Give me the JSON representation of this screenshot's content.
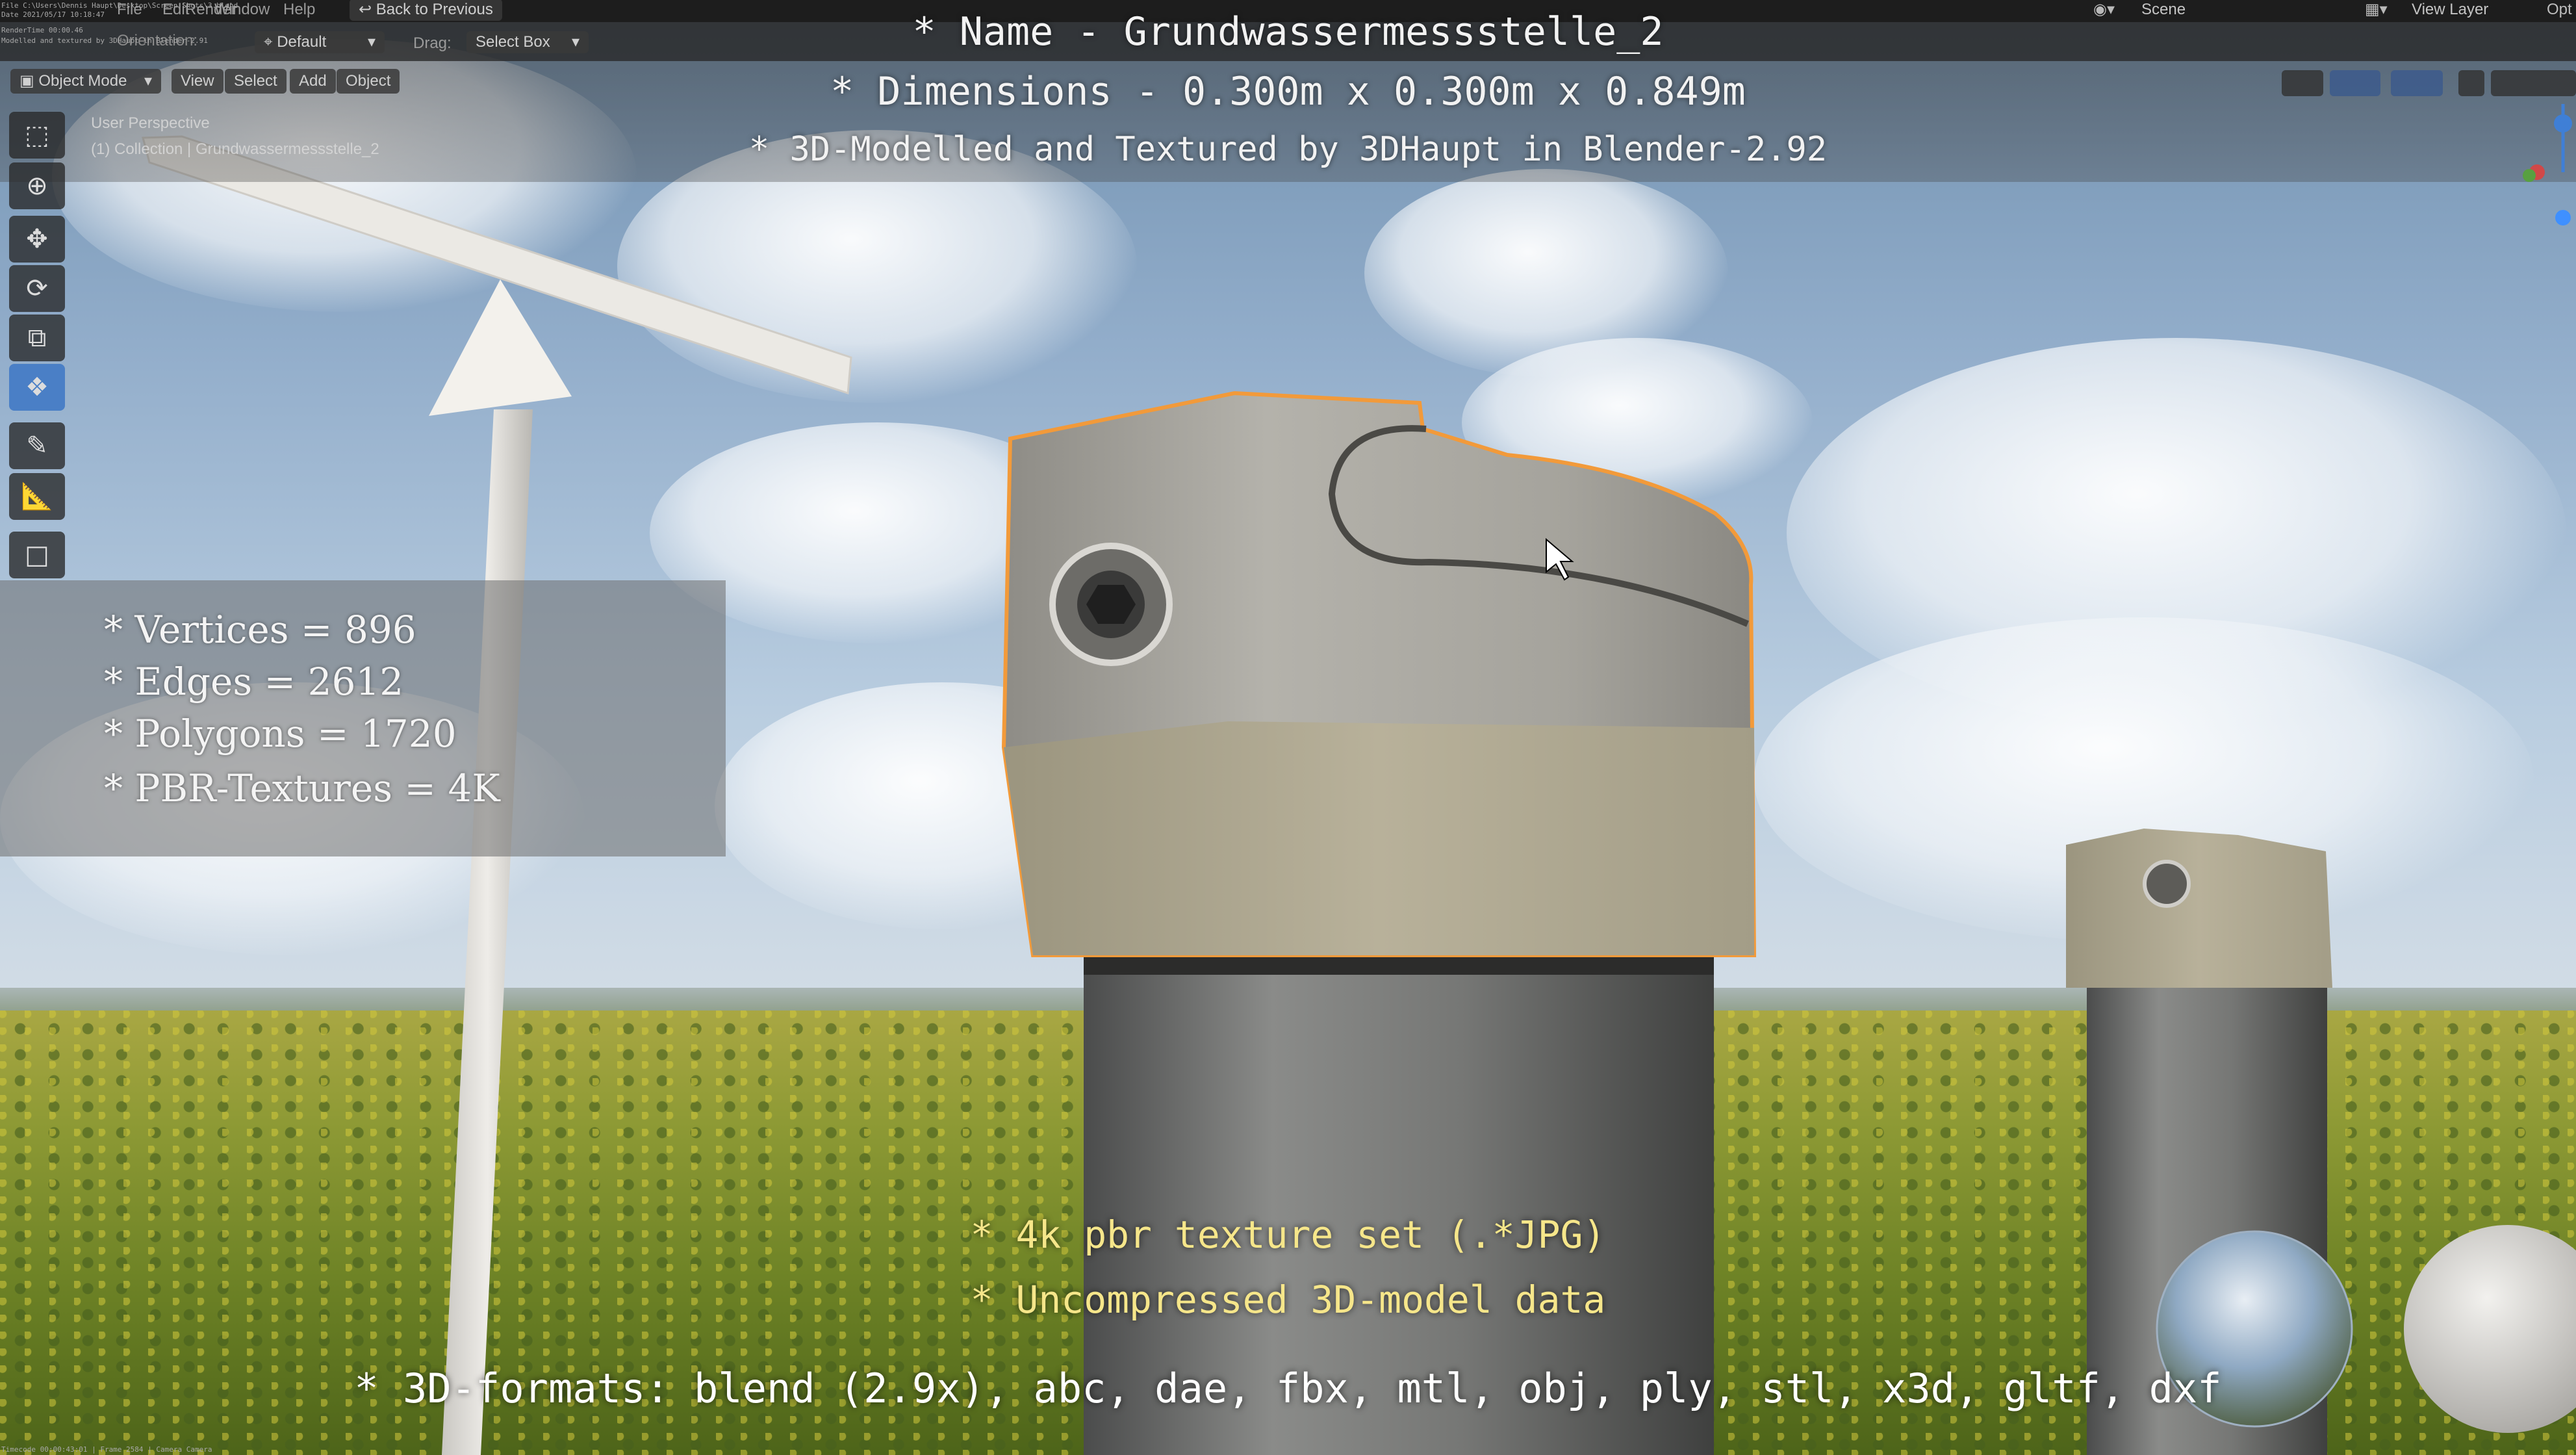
{
  "window": {
    "topbar_menu": [
      "File",
      "Edit",
      "Render",
      "Window",
      "Help"
    ],
    "back_button": "Back to Previous",
    "scene_label": "Scene",
    "view_layer_label": "View Layer",
    "options_label": "Opt"
  },
  "header": {
    "orientation_label": "Orientation:",
    "transform_default": "Default",
    "drag_label": "Drag:",
    "drag_value": "Select Box"
  },
  "viewport_header": {
    "mode": "Object Mode",
    "menus": [
      "View",
      "Select",
      "Add",
      "Object"
    ]
  },
  "viewport": {
    "perspective": "User Perspective",
    "collection": "(1) Collection | Grundwassermessstelle_2"
  },
  "overlay": {
    "name_line": "* Name - Grundwassermessstelle_2",
    "dimensions_line": "* Dimensions -  0.300m x 0.300m x 0.849m",
    "credit_line": "* 3D-Modelled and Textured by 3DHaupt in Blender-2.92"
  },
  "stats": {
    "vertices": "* Vertices = 896",
    "edges": "* Edges = 2612",
    "polygons": "* Polygons = 1720",
    "textures": "* PBR-Textures = 4K"
  },
  "bottom": {
    "texture_line": "* 4k pbr texture set (.*JPG)",
    "model_line": "* Uncompressed 3D-model data",
    "formats_line": "* 3D-formats: blend (2.9x), abc, dae, fbx, mtl, obj, ply, stl, x3d, gltf, dxf"
  },
  "colors": {
    "accent_text": "#f2f2f2",
    "highlight_text": "#f6e68a",
    "selection_outline": "#f29a3a",
    "active_tool": "#4a7fc6"
  }
}
